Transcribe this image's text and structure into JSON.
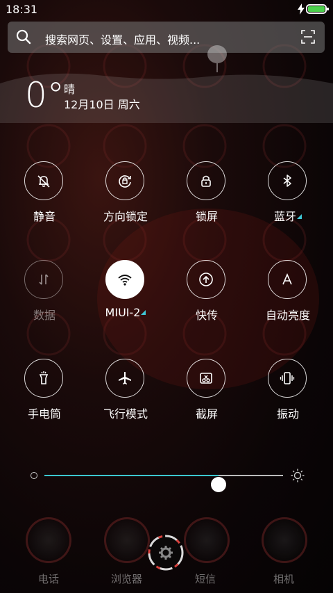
{
  "status": {
    "time": "18:31",
    "battery_color": "#4cd04c"
  },
  "search": {
    "placeholder": "搜索网页、设置、应用、视频..."
  },
  "weather": {
    "temperature": "0°",
    "condition": "晴",
    "date": "12月10日 周六"
  },
  "toggles": [
    {
      "label": "静音",
      "icon": "bell-off-icon",
      "active": false
    },
    {
      "label": "方向锁定",
      "icon": "rotation-lock-icon",
      "active": false
    },
    {
      "label": "锁屏",
      "icon": "lock-icon",
      "active": false
    },
    {
      "label": "蓝牙",
      "icon": "bluetooth-icon",
      "active": false,
      "expandable": true
    },
    {
      "label": "数据",
      "icon": "mobile-data-icon",
      "active": false,
      "disabled": true
    },
    {
      "label": "MIUI-2",
      "icon": "wifi-icon",
      "active": true,
      "expandable": true
    },
    {
      "label": "快传",
      "icon": "share-icon",
      "active": false
    },
    {
      "label": "自动亮度",
      "icon": "auto-brightness-icon",
      "active": false
    },
    {
      "label": "手电筒",
      "icon": "flashlight-icon",
      "active": false
    },
    {
      "label": "飞行模式",
      "icon": "airplane-icon",
      "active": false
    },
    {
      "label": "截屏",
      "icon": "screenshot-icon",
      "active": false
    },
    {
      "label": "振动",
      "icon": "vibrate-icon",
      "active": false
    }
  ],
  "brightness": {
    "level_percent": 73,
    "accent": "#3cc7cf"
  },
  "dock": {
    "items": [
      "电话",
      "浏览器",
      "短信",
      "相机"
    ]
  }
}
